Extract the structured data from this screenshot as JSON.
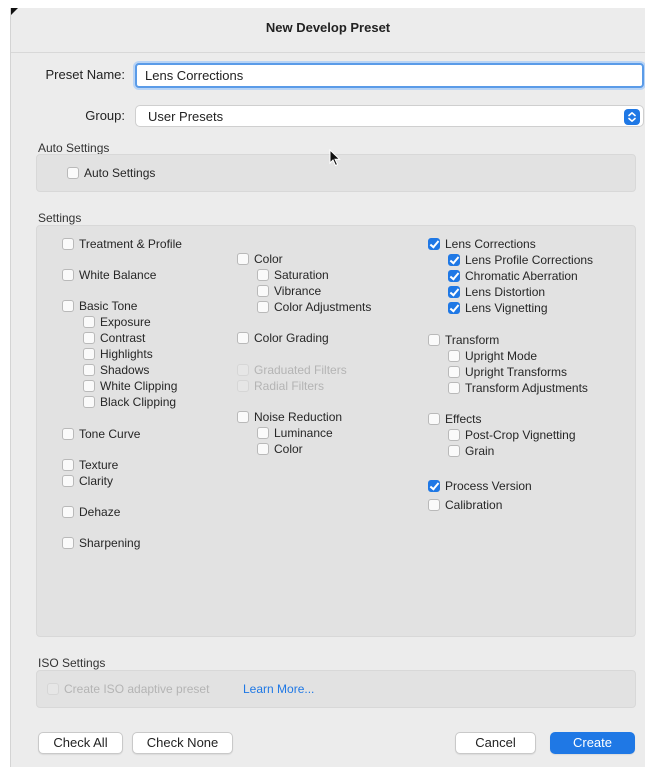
{
  "dialog": {
    "title": "New Develop Preset"
  },
  "preset_name": {
    "label": "Preset Name:",
    "value": "Lens Corrections"
  },
  "group": {
    "label": "Group:",
    "selected": "User Presets"
  },
  "auto_settings": {
    "section_title": "Auto Settings",
    "checkbox_label": "Auto Settings",
    "checked": false
  },
  "settings": {
    "section_title": "Settings",
    "col1": {
      "treatment_profile": "Treatment & Profile",
      "white_balance": "White Balance",
      "basic_tone": "Basic Tone",
      "exposure": "Exposure",
      "contrast": "Contrast",
      "highlights": "Highlights",
      "shadows": "Shadows",
      "white_clipping": "White Clipping",
      "black_clipping": "Black Clipping",
      "tone_curve": "Tone Curve",
      "texture": "Texture",
      "clarity": "Clarity",
      "dehaze": "Dehaze",
      "sharpening": "Sharpening"
    },
    "col2": {
      "color": "Color",
      "saturation": "Saturation",
      "vibrance": "Vibrance",
      "color_adjustments": "Color Adjustments",
      "color_grading": "Color Grading",
      "graduated_filters": "Graduated Filters",
      "radial_filters": "Radial Filters",
      "noise_reduction": "Noise Reduction",
      "luminance": "Luminance",
      "nr_color": "Color"
    },
    "col3": {
      "lens_corrections": "Lens Corrections",
      "lens_profile_corrections": "Lens Profile Corrections",
      "chromatic_aberration": "Chromatic Aberration",
      "lens_distortion": "Lens Distortion",
      "lens_vignetting": "Lens Vignetting",
      "transform": "Transform",
      "upright_mode": "Upright Mode",
      "upright_transforms": "Upright Transforms",
      "transform_adjustments": "Transform Adjustments",
      "effects": "Effects",
      "post_crop_vignetting": "Post-Crop Vignetting",
      "grain": "Grain",
      "process_version": "Process Version",
      "calibration": "Calibration"
    }
  },
  "iso": {
    "section_title": "ISO Settings",
    "checkbox_label": "Create ISO adaptive preset",
    "link": "Learn More..."
  },
  "buttons": {
    "check_all": "Check All",
    "check_none": "Check None",
    "cancel": "Cancel",
    "create": "Create"
  },
  "colors": {
    "accent": "#1f78e5",
    "panel": "#e2e2e2",
    "dialog": "#ececec"
  }
}
